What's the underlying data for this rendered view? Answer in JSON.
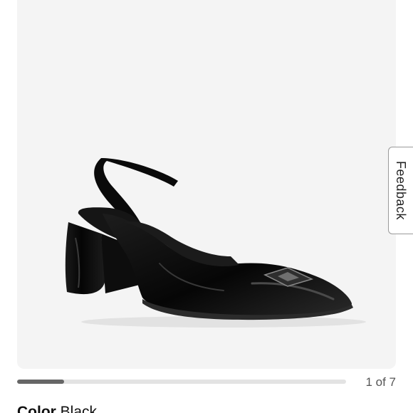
{
  "gallery": {
    "image_alt": "Black patent slingback pump",
    "current_index": 1,
    "total": 7,
    "counter_text": "1 of 7",
    "progress_fraction": 0.143
  },
  "product": {
    "color_label": "Color",
    "color_value": "Black"
  },
  "feedback": {
    "label": "Feedback"
  },
  "colors": {
    "image_bg": "#f4f4f4",
    "progress_track": "#e3e3e3",
    "progress_fill": "#666666",
    "shoe": "#0b0b0b"
  }
}
